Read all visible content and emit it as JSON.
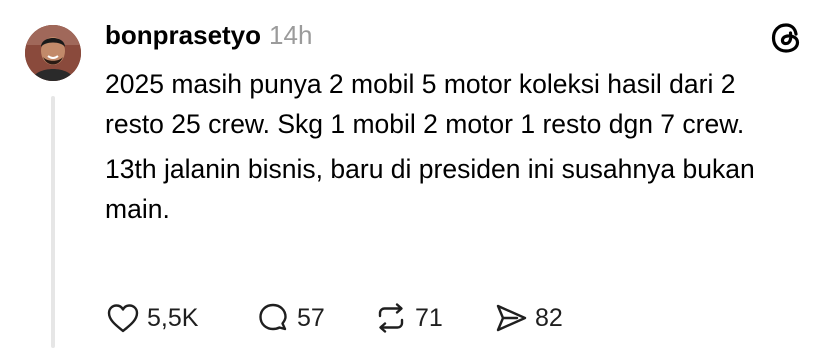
{
  "post": {
    "username": "bonprasetyo",
    "time": "14h",
    "paragraphs": [
      "2025 masih punya 2 mobil 5 motor koleksi hasil dari 2 resto 25 crew. Skg 1 mobil 2 motor 1 resto dgn 7 crew.",
      "13th jalanin bisnis, baru di presiden ini susahnya bukan main."
    ]
  },
  "actions": {
    "likes": "5,5K",
    "replies": "57",
    "reposts": "71",
    "shares": "82"
  },
  "icons": {
    "like": "heart-icon",
    "reply": "comment-bubble-icon",
    "repost": "repost-arrows-icon",
    "share": "send-icon",
    "brand": "threads-logo-icon"
  },
  "colors": {
    "text": "#000000",
    "muted": "#9b9b9b",
    "icon": "#1f1f1f",
    "thread_line": "#e6e6e6"
  }
}
